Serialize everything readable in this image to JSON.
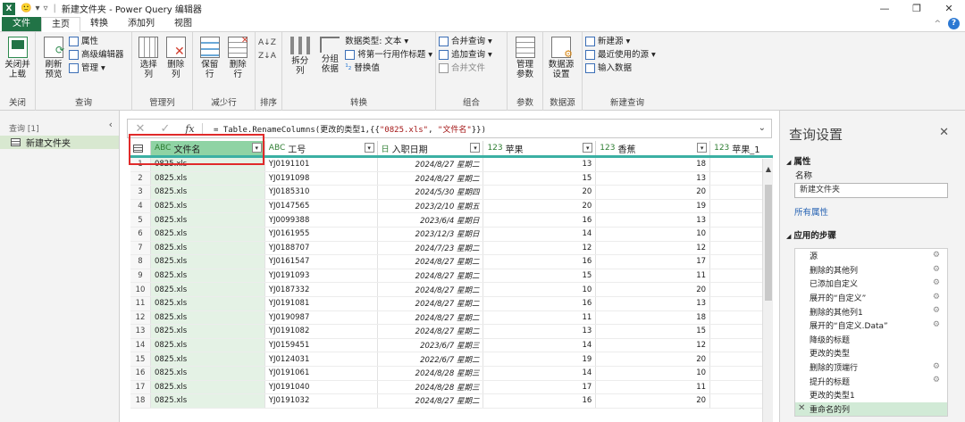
{
  "titlebar": {
    "app_icon": "X",
    "title": "新建文件夹 - Power Query 编辑器",
    "smiley": "🙂"
  },
  "window_controls": {
    "minimize": "—",
    "restore": "❐",
    "close": "✕"
  },
  "tabs": [
    "文件",
    "主页",
    "转换",
    "添加列",
    "视图"
  ],
  "ribbon": {
    "close": {
      "label": "关闭并\n上载",
      "group": "关闭"
    },
    "query": {
      "refresh": "刷新\n预览",
      "props": "属性",
      "adv": "高级编辑器",
      "manage": "管理",
      "group": "查询"
    },
    "manage_cols": {
      "choose": "选择\n列",
      "remove": "删除\n列",
      "group": "管理列"
    },
    "reduce": {
      "keep": "保留\n行",
      "remove": "删除\n行",
      "group": "减少行"
    },
    "sort": {
      "group": "排序"
    },
    "transform": {
      "split": "拆分\n列",
      "groupby": "分组\n依据",
      "dtype": "数据类型: 文本 ▾",
      "firstrow": "将第一行用作标题 ▾",
      "replace": "替换值",
      "group": "转换"
    },
    "combine": {
      "merge": "合并查询 ▾",
      "append": "追加查询 ▾",
      "files": "合并文件",
      "group": "组合"
    },
    "params": {
      "label": "管理\n参数",
      "group": "参数"
    },
    "datasource": {
      "label": "数据源\n设置",
      "group": "数据源"
    },
    "newquery": {
      "new": "新建源 ▾",
      "recent": "最近使用的源 ▾",
      "enter": "输入数据",
      "group": "新建查询"
    }
  },
  "queries": {
    "header": "查询 [1]",
    "items": [
      "新建文件夹"
    ]
  },
  "formula": {
    "prefix": "= Table.RenameColumns(更改的类型1,{{",
    "s1": "\"0825.xls\"",
    "mid": ", ",
    "s2": "\"文件名\"",
    "suffix": "}})"
  },
  "table": {
    "headers": [
      {
        "type": "ABC",
        "name": "文件名"
      },
      {
        "type": "ABC",
        "name": "工号"
      },
      {
        "type": "日",
        "name": "入职日期"
      },
      {
        "type": "123",
        "name": "苹果"
      },
      {
        "type": "123",
        "name": "香蕉"
      },
      {
        "type": "123",
        "name": "苹果_1"
      }
    ],
    "rows": [
      [
        "1",
        "0825.xls",
        "YJ0191101",
        "2024/8/27 星期二",
        "13",
        "18"
      ],
      [
        "2",
        "0825.xls",
        "YJ0191098",
        "2024/8/27 星期二",
        "15",
        "13"
      ],
      [
        "3",
        "0825.xls",
        "YJ0185310",
        "2024/5/30 星期四",
        "20",
        "20"
      ],
      [
        "4",
        "0825.xls",
        "YJ0147565",
        "2023/2/10 星期五",
        "20",
        "19"
      ],
      [
        "5",
        "0825.xls",
        "YJ0099388",
        "2023/6/4 星期日",
        "16",
        "13"
      ],
      [
        "6",
        "0825.xls",
        "YJ0161955",
        "2023/12/3 星期日",
        "14",
        "10"
      ],
      [
        "7",
        "0825.xls",
        "YJ0188707",
        "2024/7/23 星期二",
        "12",
        "12"
      ],
      [
        "8",
        "0825.xls",
        "YJ0161547",
        "2024/8/27 星期二",
        "16",
        "17"
      ],
      [
        "9",
        "0825.xls",
        "YJ0191093",
        "2024/8/27 星期二",
        "15",
        "11"
      ],
      [
        "10",
        "0825.xls",
        "YJ0187332",
        "2024/8/27 星期二",
        "10",
        "20"
      ],
      [
        "11",
        "0825.xls",
        "YJ0191081",
        "2024/8/27 星期二",
        "16",
        "13"
      ],
      [
        "12",
        "0825.xls",
        "YJ0190987",
        "2024/8/27 星期二",
        "11",
        "18"
      ],
      [
        "13",
        "0825.xls",
        "YJ0191082",
        "2024/8/27 星期二",
        "13",
        "15"
      ],
      [
        "14",
        "0825.xls",
        "YJ0159451",
        "2023/6/7 星期三",
        "14",
        "12"
      ],
      [
        "15",
        "0825.xls",
        "YJ0124031",
        "2022/6/7 星期二",
        "19",
        "20"
      ],
      [
        "16",
        "0825.xls",
        "YJ0191061",
        "2024/8/28 星期三",
        "14",
        "10"
      ],
      [
        "17",
        "0825.xls",
        "YJ0191040",
        "2024/8/28 星期三",
        "17",
        "11"
      ],
      [
        "18",
        "0825.xls",
        "YJ0191032",
        "2024/8/27 星期二",
        "16",
        "20"
      ]
    ]
  },
  "settings": {
    "title": "查询设置",
    "props": "属性",
    "name_label": "名称",
    "name_value": "新建文件夹",
    "all_props": "所有属性",
    "steps_title": "应用的步骤",
    "steps": [
      "源",
      "删除的其他列",
      "已添加自定义",
      "展开的“自定义”",
      "删除的其他列1",
      "展开的“自定义.Data”",
      "降级的标题",
      "更改的类型",
      "删除的顶端行",
      "提升的标题",
      "更改的类型1",
      "重命名的列"
    ],
    "step_gears": [
      true,
      true,
      true,
      true,
      true,
      true,
      false,
      false,
      true,
      true,
      false,
      false
    ]
  },
  "colors": {
    "excel_green": "#217346",
    "selected_col": "#8fd3a4",
    "highlight_box": "#e02a2a"
  }
}
